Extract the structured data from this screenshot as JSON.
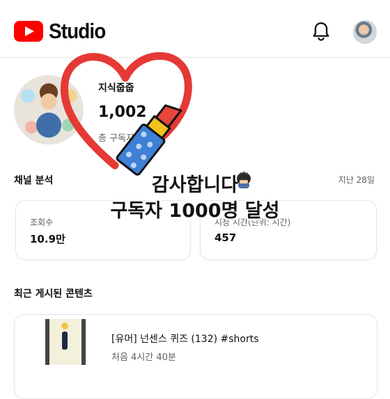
{
  "header": {
    "app_name": "Studio",
    "icons": [
      "youtube-logo-icon",
      "bell-icon",
      "account-avatar"
    ]
  },
  "channel": {
    "name": "지식줍줍",
    "subscriber_count": "1,002",
    "subscriber_label": "총 구독자"
  },
  "analytics": {
    "title": "채널 분석",
    "period": "지난 28일",
    "metrics": [
      {
        "label": "조회수",
        "value": "10.9만"
      },
      {
        "label": "시청 시간(단위: 시간)",
        "value": "457"
      }
    ]
  },
  "recent": {
    "title": "최근 게시된 콘텐츠",
    "items": [
      {
        "title": "[유머] 넌센스 퀴즈 (132) #shorts",
        "meta": "처음 4시간 40분"
      }
    ]
  },
  "overlay": {
    "line1": "감사합니다",
    "line2": "구독자  1000명  달성",
    "colors": {
      "heart": "#e53935",
      "lipstick_tube": "#3f7fd6",
      "lipstick_tip": "#e8473a",
      "lipstick_band": "#f2c21b"
    }
  }
}
